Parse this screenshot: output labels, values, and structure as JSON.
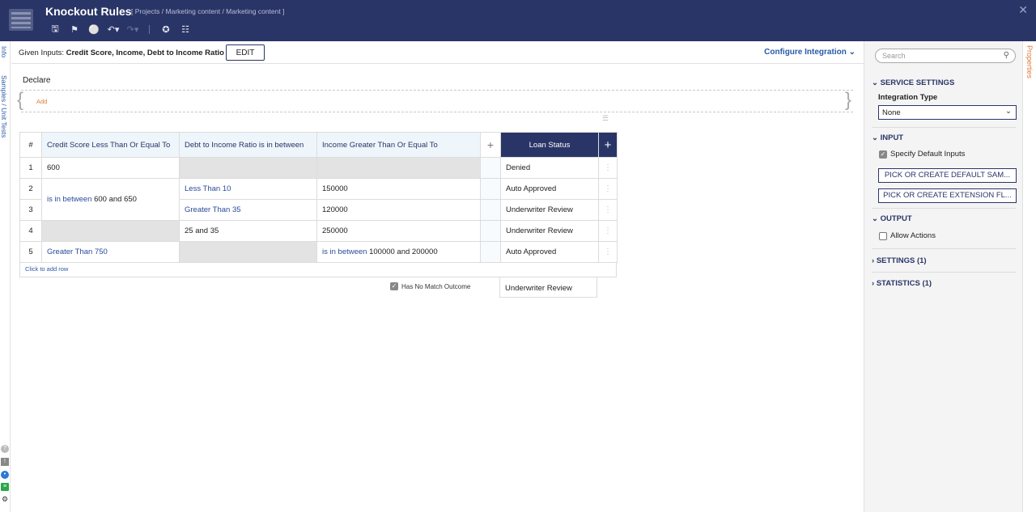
{
  "header": {
    "title": "Knockout Rules",
    "breadcrumb": "[ Projects / Marketing content / Marketing content ]"
  },
  "left_rail": {
    "tabs": [
      "Info",
      "Samples / Unit Tests"
    ]
  },
  "inputs_bar": {
    "given_prefix": "Given Inputs:",
    "given_values": "Credit Score, Income, Debt to Income Ratio",
    "edit_label": "EDIT",
    "configure_label": "Configure Integration"
  },
  "declare": {
    "label": "Declare",
    "add_label": "Add"
  },
  "table": {
    "columns": {
      "num": "#",
      "credit": "Credit Score Less Than Or Equal To",
      "debt": "Debt to Income Ratio is in between",
      "income": "Income Greater Than Or Equal To",
      "add": "+",
      "status": "Loan Status",
      "add_output": "+"
    },
    "rows": {
      "r1": {
        "num": "1",
        "credit": "600",
        "status": "Denied"
      },
      "r23": {
        "credit_op": "is in between",
        "credit_val": "600 and 650"
      },
      "r2": {
        "num": "2",
        "debt_op": "Less Than",
        "debt_val": "10",
        "income": "150000",
        "status": "Auto Approved"
      },
      "r3": {
        "num": "3",
        "debt_op": "Greater Than",
        "debt_val": "35",
        "income": "120000",
        "status": "Underwriter Review"
      },
      "r4": {
        "num": "4",
        "debt": "25 and 35",
        "income": "250000",
        "status": "Underwriter Review"
      },
      "r5": {
        "num": "5",
        "credit_op": "Greater Than",
        "credit_val": "750",
        "income_op": "is in between",
        "income_val": "100000 and 200000",
        "status": "Auto Approved"
      }
    },
    "add_row_label": "Click to add row",
    "no_match_label": "Has No Match Outcome",
    "no_match_value": "Underwriter Review"
  },
  "properties": {
    "search_placeholder": "Search",
    "service_settings": "SERVICE SETTINGS",
    "integration_type_label": "Integration Type",
    "integration_type_value": "None",
    "input": "INPUT",
    "specify_default_inputs": "Specify Default Inputs",
    "pick_default_sample": "PICK OR CREATE DEFAULT SAM...",
    "pick_extension": "PICK OR CREATE EXTENSION FL...",
    "output": "OUTPUT",
    "allow_actions": "Allow Actions",
    "settings": "SETTINGS (1)",
    "statistics": "STATISTICS (1)",
    "tab_label": "Properties"
  },
  "colors": {
    "header_bg": "#2a3567",
    "accent": "#2a5aa6",
    "orange": "#e07a3a"
  }
}
